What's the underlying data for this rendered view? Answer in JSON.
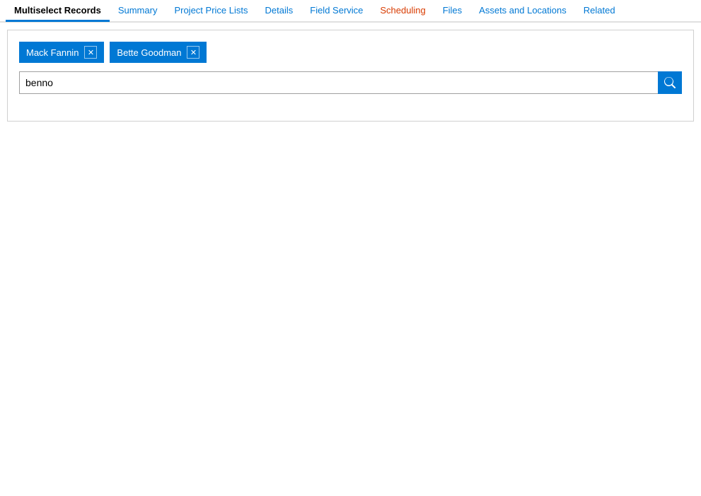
{
  "nav": {
    "tabs": [
      {
        "id": "multiselect-records",
        "label": "Multiselect Records",
        "active": true,
        "color": "default"
      },
      {
        "id": "summary",
        "label": "Summary",
        "active": false,
        "color": "default"
      },
      {
        "id": "project-price-lists",
        "label": "Project Price Lists",
        "active": false,
        "color": "default"
      },
      {
        "id": "details",
        "label": "Details",
        "active": false,
        "color": "default"
      },
      {
        "id": "field-service",
        "label": "Field Service",
        "active": false,
        "color": "default"
      },
      {
        "id": "scheduling",
        "label": "Scheduling",
        "active": false,
        "color": "scheduling"
      },
      {
        "id": "files",
        "label": "Files",
        "active": false,
        "color": "default"
      },
      {
        "id": "assets-and-locations",
        "label": "Assets and Locations",
        "active": false,
        "color": "default"
      },
      {
        "id": "related",
        "label": "Related",
        "active": false,
        "color": "default"
      }
    ]
  },
  "content": {
    "tags": [
      {
        "id": "tag-mack-fannin",
        "label": "Mack Fannin"
      },
      {
        "id": "tag-bette-goodman",
        "label": "Bette Goodman"
      }
    ],
    "search": {
      "value": "benno",
      "placeholder": "",
      "button_label": "Search"
    }
  }
}
